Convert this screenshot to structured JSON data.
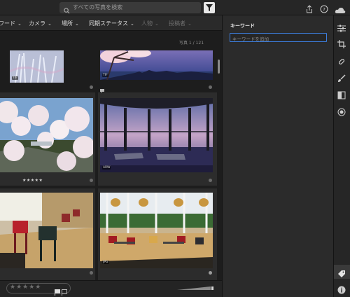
{
  "search": {
    "placeholder": "すべての写真を検索"
  },
  "filters": [
    {
      "label": "ワード",
      "enabled": true
    },
    {
      "label": "カメラ",
      "enabled": true
    },
    {
      "label": "場所",
      "enabled": true
    },
    {
      "label": "同期ステータス",
      "enabled": true
    },
    {
      "label": "人物",
      "enabled": false
    },
    {
      "label": "投稿者",
      "enabled": false
    }
  ],
  "grid": {
    "count_label": "写真 1 / 121",
    "photos": [
      {
        "badge": "TIF",
        "subject": "frosted branches"
      },
      {
        "badge": "TIF",
        "subject": "cherry blossom panorama"
      },
      {
        "badge": "",
        "subject": "cherry blossoms over river",
        "rating_text": "★★★★★"
      },
      {
        "badge": "ARW",
        "subject": "glass terrace at dusk"
      },
      {
        "badge": "",
        "subject": "cafe chairs"
      },
      {
        "badge": "JPG",
        "subject": "cafe interior with lamps"
      }
    ]
  },
  "bottombar": {
    "stars": "★★★★★"
  },
  "panel": {
    "title": "キーワード",
    "keyword_placeholder": "キーワードを追加"
  },
  "icons": [
    "search-icon",
    "filter-icon",
    "share-icon",
    "help-icon",
    "cloud-icon",
    "sliders-icon",
    "crop-icon",
    "bandaid-icon",
    "brush-icon",
    "gradient-icon",
    "radial-icon",
    "tag-icon",
    "info-icon"
  ],
  "colors": {
    "accent": "#3d7fe0",
    "panel_bg": "#2b2b2b",
    "grid_bg": "#1d1d1d"
  }
}
